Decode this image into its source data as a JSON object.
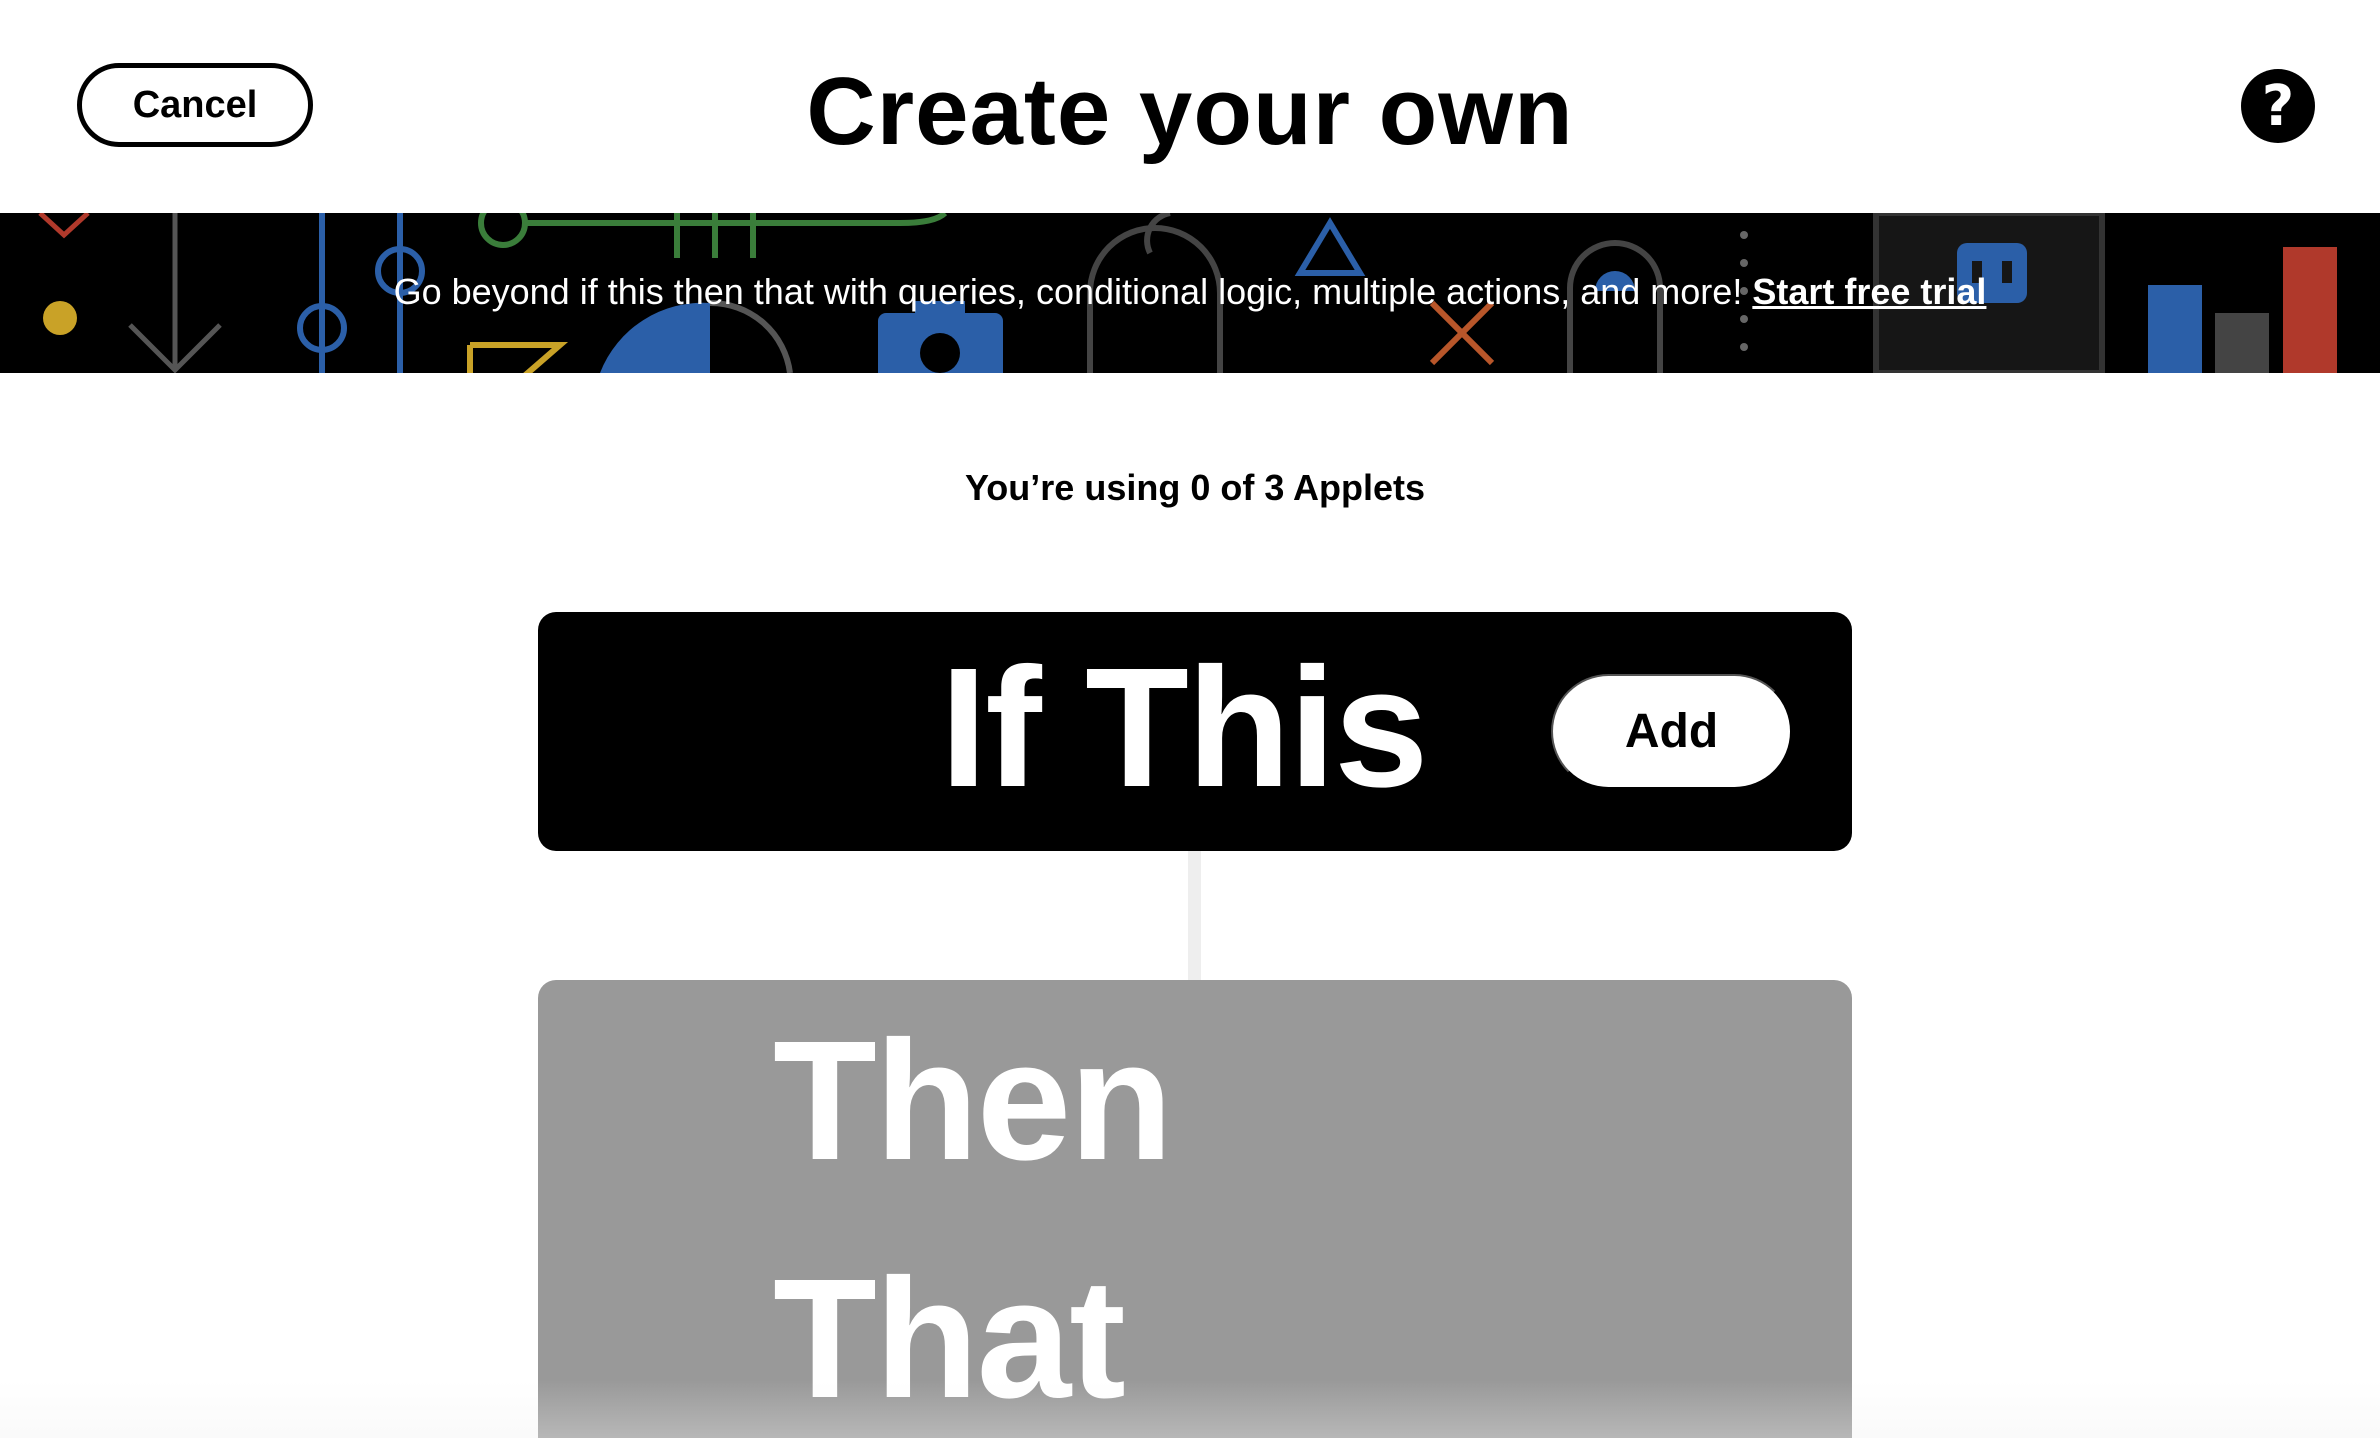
{
  "header": {
    "cancel_label": "Cancel",
    "title": "Create your own",
    "help_icon": "question-mark-icon",
    "help_glyph": "?"
  },
  "banner": {
    "text": "Go beyond if this then that with queries, conditional logic, multiple actions, and more!",
    "link_label": "Start free trial"
  },
  "usage": {
    "text": "You’re using 0 of 3 Applets"
  },
  "trigger": {
    "label": "If This",
    "add_label": "Add"
  },
  "action": {
    "label_line1": "Then",
    "label_line2": "That"
  },
  "colors": {
    "banner_bg": "#000000",
    "trigger_bg": "#000000",
    "action_bg": "#999999",
    "connector": "#eeeeee"
  }
}
